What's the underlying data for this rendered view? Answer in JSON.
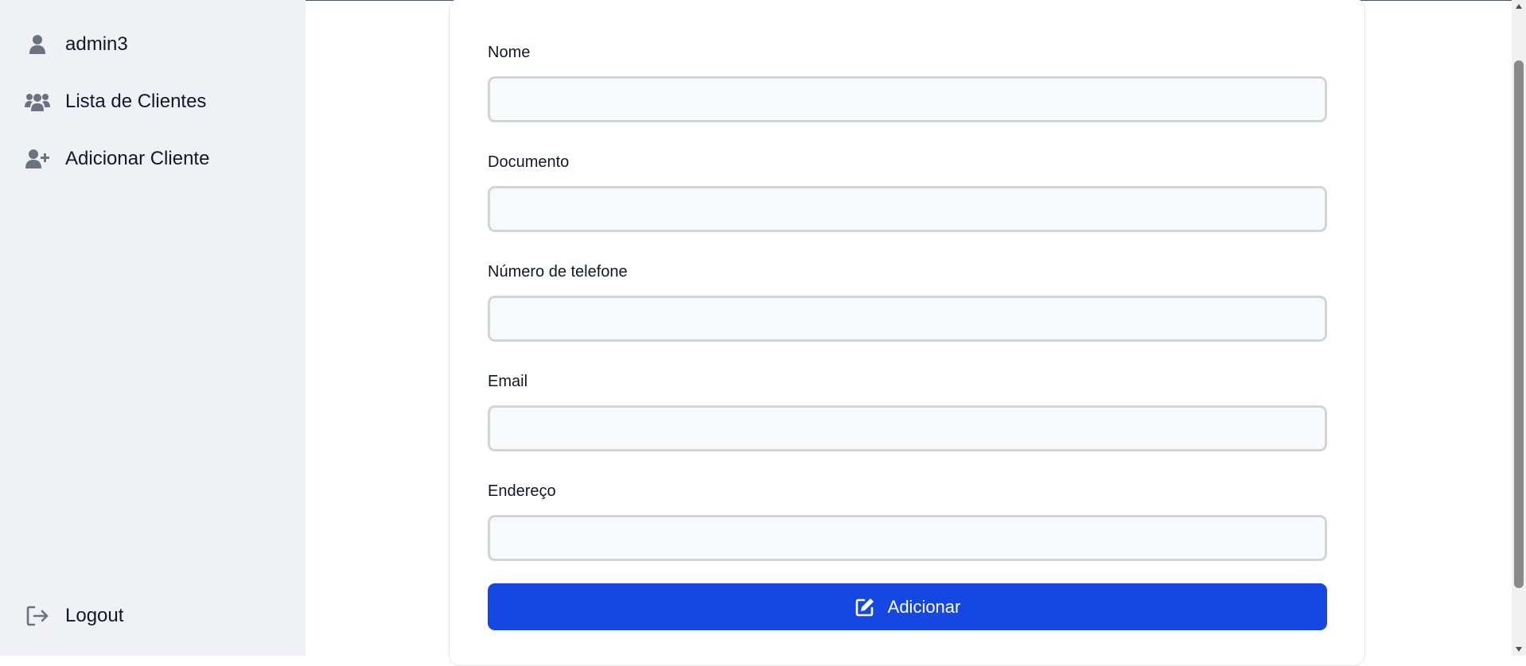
{
  "sidebar": {
    "user": {
      "label": "admin3",
      "icon": "user-icon"
    },
    "items": [
      {
        "label": "Lista de Clientes",
        "icon": "users-icon"
      },
      {
        "label": "Adicionar Cliente",
        "icon": "user-plus-icon"
      }
    ],
    "logout": {
      "label": "Logout",
      "icon": "logout-icon"
    }
  },
  "form": {
    "fields": [
      {
        "label": "Nome",
        "value": "",
        "placeholder": ""
      },
      {
        "label": "Documento",
        "value": "",
        "placeholder": ""
      },
      {
        "label": "Número de telefone",
        "value": "",
        "placeholder": ""
      },
      {
        "label": "Email",
        "value": "",
        "placeholder": ""
      },
      {
        "label": "Endereço",
        "value": "",
        "placeholder": ""
      }
    ],
    "submit_label": "Adicionar",
    "submit_icon": "edit-icon"
  },
  "colors": {
    "sidebar_bg": "#f0f1f4",
    "accent": "#1547e3",
    "icon_gray": "#6b7280",
    "input_border": "#d1d5db",
    "input_bg": "#f8f9fb"
  }
}
